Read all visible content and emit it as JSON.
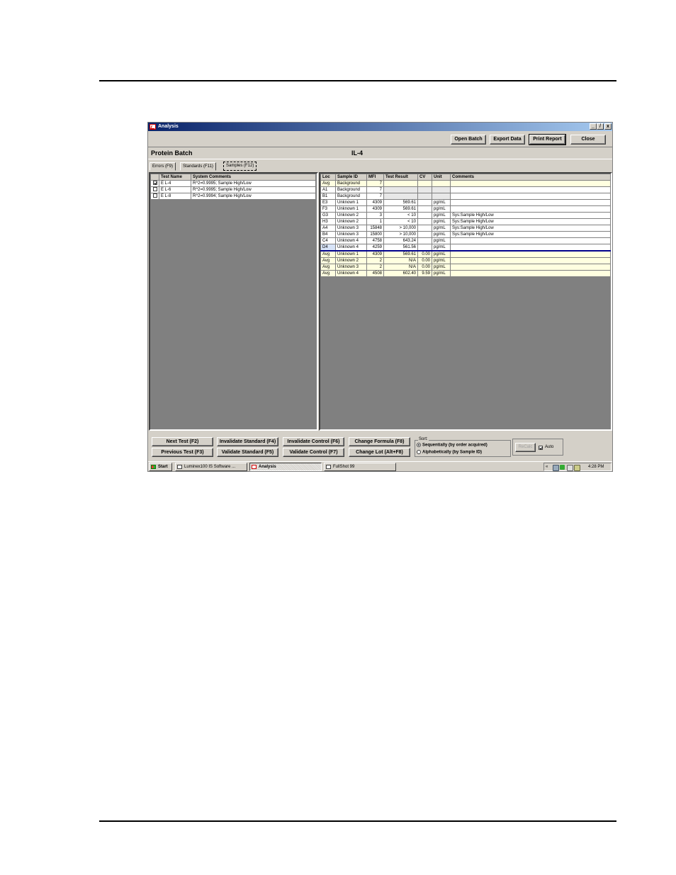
{
  "window": {
    "title": "Analysis",
    "min": "_",
    "max": "̸",
    "close": "x"
  },
  "toolbar": {
    "open_batch": "Open Batch",
    "export_data": "Export Data",
    "print_report": "Print Report",
    "close": "Close"
  },
  "header": {
    "batch": "Protein Batch",
    "test": "IL-4"
  },
  "tabs": [
    "Errors (F9)",
    "Standards (F11)",
    "Samples (F12)"
  ],
  "tests": {
    "columns": [
      "",
      "Test Name",
      "System Comments"
    ],
    "rows": [
      {
        "checked": true,
        "name": "E L-4",
        "comment": "R^2=0.9995; Sample High/Low"
      },
      {
        "checked": false,
        "name": "E L-6",
        "comment": "R^2=0.9995; Sample High/Low"
      },
      {
        "checked": false,
        "name": "E L-8",
        "comment": "R^2=0.9994; Sample High/Low"
      }
    ]
  },
  "samples": {
    "columns": [
      "Loc",
      "Sample ID",
      "MFI",
      "Test Result",
      "CV",
      "Unit",
      "Comments"
    ],
    "rows": [
      {
        "loc": "Avg",
        "id": "Background",
        "mfi": "7",
        "result": "",
        "cv": "",
        "unit": "",
        "comment": "",
        "style": "yellow"
      },
      {
        "loc": "A1",
        "id": "Background",
        "mfi": "7",
        "result": "",
        "cv": "",
        "unit": "",
        "comment": "",
        "style": "white"
      },
      {
        "loc": "B1",
        "id": "Background",
        "mfi": "7",
        "result": "",
        "cv": "",
        "unit": "",
        "comment": "",
        "style": "white"
      },
      {
        "loc": "E3",
        "id": "Unknown 1",
        "mfi": "4309",
        "result": "569.61",
        "cv": "",
        "unit": "pg/mL",
        "comment": "",
        "style": "white"
      },
      {
        "loc": "F3",
        "id": "Unknown 1",
        "mfi": "4309",
        "result": "569.61",
        "cv": "",
        "unit": "pg/mL",
        "comment": "",
        "style": "white"
      },
      {
        "loc": "G3",
        "id": "Unknown 2",
        "mfi": "3",
        "result": "< 10",
        "cv": "",
        "unit": "pg/mL",
        "comment": "Sys:Sample High/Low",
        "style": "white"
      },
      {
        "loc": "H3",
        "id": "Unknown 2",
        "mfi": "1",
        "result": "< 10",
        "cv": "",
        "unit": "pg/mL",
        "comment": "Sys:Sample High/Low",
        "style": "white"
      },
      {
        "loc": "A4",
        "id": "Unknown 3",
        "mfi": "15848",
        "result": "> 10,000",
        "cv": "",
        "unit": "pg/mL",
        "comment": "Sys:Sample High/Low",
        "style": "white"
      },
      {
        "loc": "B4",
        "id": "Unknown 3",
        "mfi": "15800",
        "result": "> 10,000",
        "cv": "",
        "unit": "pg/mL",
        "comment": "Sys:Sample High/Low",
        "style": "white"
      },
      {
        "loc": "C4",
        "id": "Unknown 4",
        "mfi": "4758",
        "result": "643.24",
        "cv": "",
        "unit": "pg/mL",
        "comment": "",
        "style": "white"
      },
      {
        "loc": "D4",
        "id": "Unknown 4",
        "mfi": "4259",
        "result": "561.56",
        "cv": "",
        "unit": "pg/mL",
        "comment": "",
        "style": "white"
      },
      {
        "loc": "Avg",
        "id": "Unknown 1",
        "mfi": "4309",
        "result": "569.61",
        "cv": "0.00",
        "unit": "pg/mL",
        "comment": "",
        "style": "yellow"
      },
      {
        "loc": "Avg",
        "id": "Unknown 2",
        "mfi": "2",
        "result": "N/A",
        "cv": "0.00",
        "unit": "pg/mL",
        "comment": "",
        "style": "yellow"
      },
      {
        "loc": "Avg",
        "id": "Unknown 3",
        "mfi": "2",
        "result": "N/A",
        "cv": "0.00",
        "unit": "pg/mL",
        "comment": "",
        "style": "yellow"
      },
      {
        "loc": "Avg",
        "id": "Unknown 4",
        "mfi": "4508",
        "result": "602.40",
        "cv": "9.59",
        "unit": "pg/mL",
        "comment": "",
        "style": "yellow"
      }
    ]
  },
  "actions": {
    "next_test": "Next Test (F2)",
    "previous_test": "Previous Test (F3)",
    "invalidate_standard": "Invalidate Standard (F4)",
    "validate_standard": "Validate Standard (F5)",
    "invalidate_control": "Invalidate Control (F6)",
    "validate_control": "Validate Control (F7)",
    "change_formula": "Change Formula (F8)",
    "change_lot": "Change Lot (Alt+F8)"
  },
  "sort": {
    "legend": "Sort:",
    "opt1": "Sequentially (by order acquired)",
    "opt2": "Alphabetically (by Sample ID)",
    "selected": "opt1"
  },
  "recalc": {
    "label": "ReCalc",
    "auto_label": "Auto",
    "auto_checked": true
  },
  "taskbar": {
    "start": "Start",
    "items": [
      "Luminex100 IS Software ...",
      "Analysis",
      "FullShot 99"
    ],
    "active_index": 1,
    "tray_arrow": "«",
    "clock": "4:28 PM"
  },
  "colors": {
    "titlebar": "#0a246a",
    "dark_pane": "#808080",
    "avg_row": "#ffffe0",
    "red_line": "#cc0000",
    "blue_line": "#00008b"
  }
}
